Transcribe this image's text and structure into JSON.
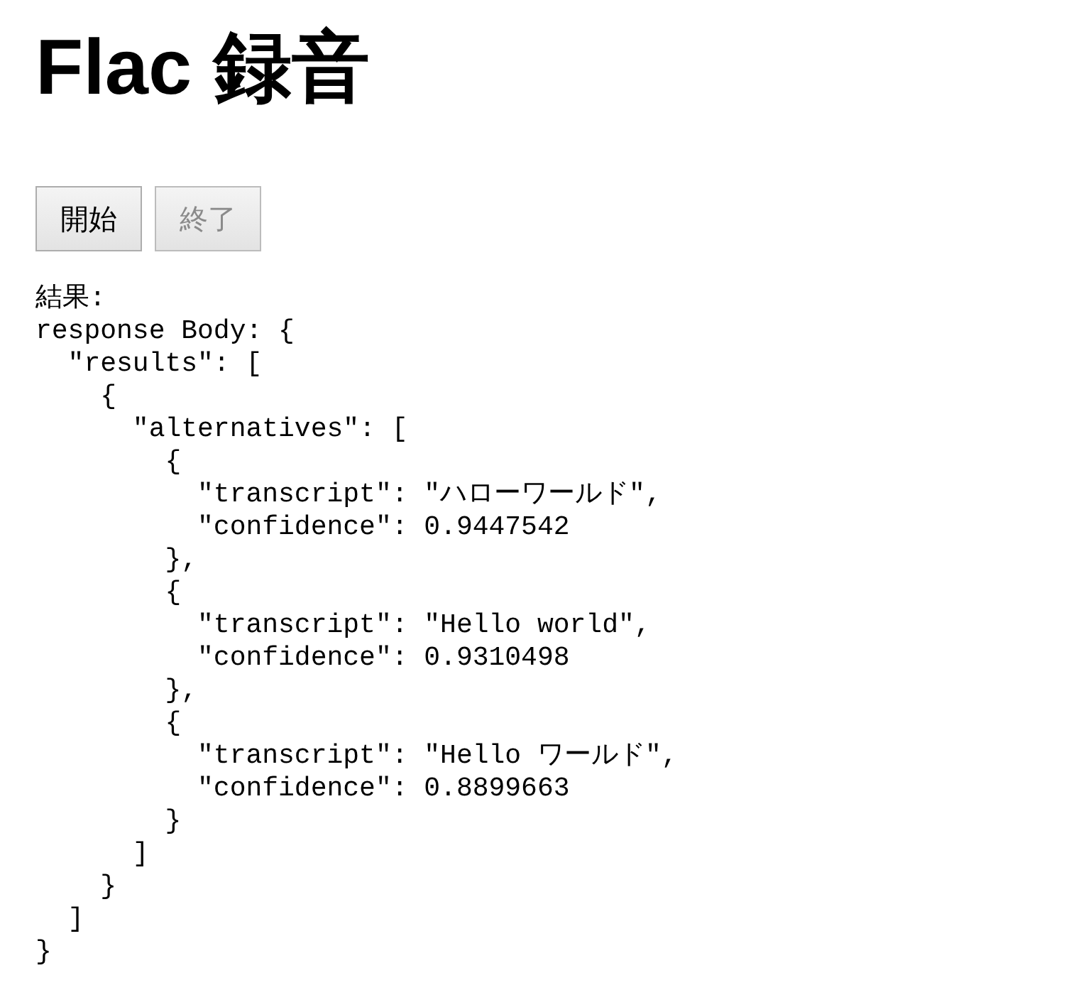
{
  "heading": "Flac 録音",
  "buttons": [
    {
      "label": "開始",
      "disabled": false
    },
    {
      "label": "終了",
      "disabled": true
    }
  ],
  "result_label": "結果:",
  "response_text": "response Body: {\n  \"results\": [\n    {\n      \"alternatives\": [\n        {\n          \"transcript\": \"ハローワールド\",\n          \"confidence\": 0.9447542\n        },\n        {\n          \"transcript\": \"Hello world\",\n          \"confidence\": 0.9310498\n        },\n        {\n          \"transcript\": \"Hello ワールド\",\n          \"confidence\": 0.8899663\n        }\n      ]\n    }\n  ]\n}"
}
